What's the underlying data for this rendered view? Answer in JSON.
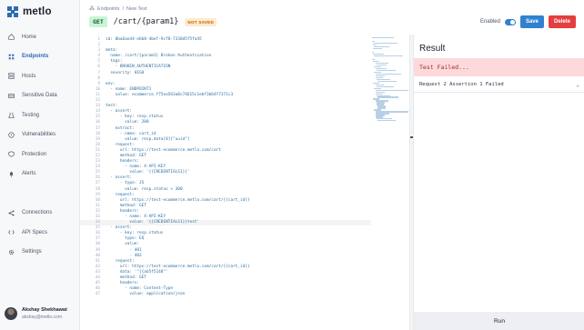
{
  "brand": {
    "name": "metlo"
  },
  "nav": {
    "items": [
      {
        "label": "Home",
        "icon": "home-icon"
      },
      {
        "label": "Endpoints",
        "icon": "endpoints-icon",
        "active": true
      },
      {
        "label": "Hosts",
        "icon": "hosts-icon"
      },
      {
        "label": "Sensitive Data",
        "icon": "sensitive-data-icon"
      },
      {
        "label": "Testing",
        "icon": "testing-icon"
      },
      {
        "label": "Vulnerabilities",
        "icon": "vulnerabilities-icon"
      },
      {
        "label": "Protection",
        "icon": "protection-icon"
      },
      {
        "label": "Alerts",
        "icon": "alerts-icon"
      },
      {
        "label": "Connections",
        "icon": "connections-icon"
      },
      {
        "label": "API Specs",
        "icon": "api-specs-icon"
      },
      {
        "label": "Settings",
        "icon": "settings-icon"
      }
    ]
  },
  "user": {
    "name": "Akshay Shekhawat",
    "email": "akshay@metlo.com"
  },
  "header": {
    "breadcrumb": [
      "Endpoints",
      "New Test"
    ],
    "method": "GET",
    "path": "/cart/{param1}",
    "status_badge": "NOT SAVED",
    "enabled_label": "Enabled",
    "enabled": true,
    "save_label": "Save",
    "delete_label": "Delete"
  },
  "editor": {
    "highlighted_line": 34,
    "lines": [
      "id: 0ba6ae44-e6b8-4bef-9cf0-7330d5f5fa45",
      "",
      "meta:",
      "  name: /cart/{param1} Broken Authentication",
      "  tags:",
      "    - BROKEN_AUTHENTICATION",
      "  severity: HIGH",
      "",
      "env:",
      "  - name: ENDPOINT1",
      "    value: ecommerce_f75ea563a0c74615c1ebf3b64f7371c3",
      "",
      "test:",
      "  - assert:",
      "      - key: resp.status",
      "        value: 200",
      "    extract:",
      "      - name: cart_id",
      "        value: resp.data[0][\"uuid\"]",
      "    request:",
      "      url: https://test-ecommerce.metlo.com/cart",
      "      method: GET",
      "      headers:",
      "        - name: X-API-KEY",
      "          value: '{{CREDENTIALS1}}'",
      "  - assert:",
      "      - type: JS",
      "        value: resp.status < 300",
      "    request:",
      "      url: https://test-ecommerce.metlo.com/cart/{{cart_id}}",
      "      method: GET",
      "      headers:",
      "        - name: X-API-KEY",
      "          value: '{{CREDENTIALS1}}test'",
      "  - assert:",
      "      - key: resp.status",
      "        type: EQ",
      "        value:",
      "          - 401",
      "          - 403",
      "    request:",
      "      url: https://test-ecommerce.metlo.com/cart/{{cart_id}}",
      "      data: '\"{{ab5f5148\"'",
      "      method: GET",
      "      headers:",
      "        - name: Content-Type",
      "          value: application/json"
    ]
  },
  "result": {
    "title": "Result",
    "status_text": "Test Failed...",
    "assertion_text": "Request 2 Assertion 1 Failed",
    "run_label": "Run"
  },
  "colors": {
    "accent": "#3182ce",
    "danger": "#e53e3e",
    "fail_bg": "#fdd9dc",
    "method_bg": "#c6f6d5"
  }
}
